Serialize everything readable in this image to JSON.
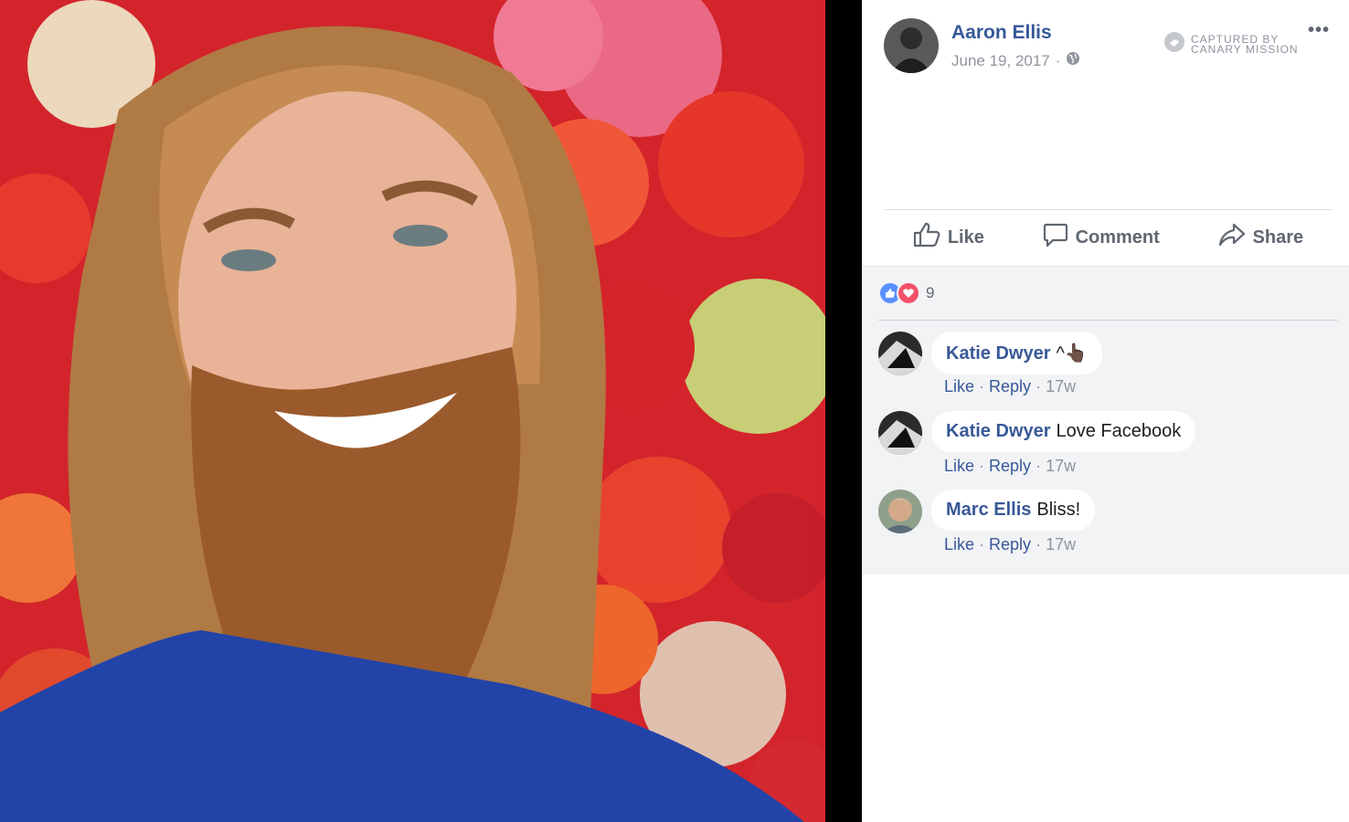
{
  "post": {
    "author": "Aaron Ellis",
    "date": "June 19, 2017",
    "separator": "·",
    "privacy_icon": "globe-icon",
    "captured_line1": "CAPTURED BY",
    "captured_line2": "CANARY MISSION",
    "more_label": "•••"
  },
  "actions": {
    "like": "Like",
    "comment": "Comment",
    "share": "Share"
  },
  "reactions": {
    "types": [
      "like",
      "love"
    ],
    "count": "9"
  },
  "comments": [
    {
      "author": "Katie Dwyer",
      "text": "^👆🏿",
      "like": "Like",
      "reply": "Reply",
      "time": "17w"
    },
    {
      "author": "Katie Dwyer",
      "text": "Love Facebook",
      "like": "Like",
      "reply": "Reply",
      "time": "17w"
    },
    {
      "author": "Marc Ellis",
      "text": "Bliss!",
      "like": "Like",
      "reply": "Reply",
      "time": "17w"
    }
  ],
  "colors": {
    "link_blue": "#365899",
    "meta_gray": "#90949c",
    "like_blue": "#5890ff",
    "love_red": "#f25268"
  }
}
